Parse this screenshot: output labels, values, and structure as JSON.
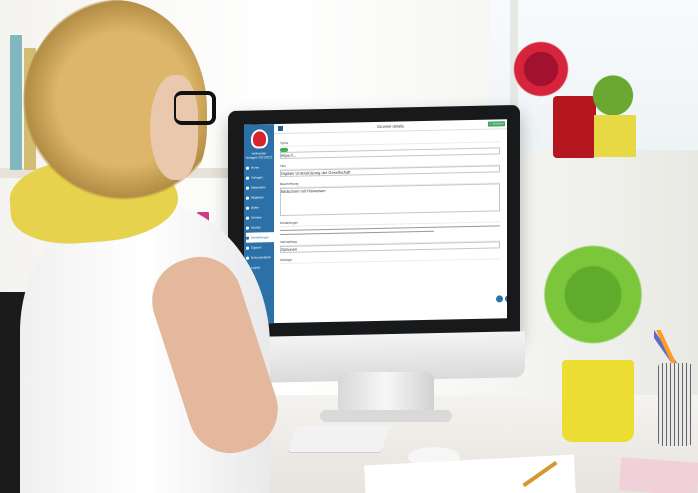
{
  "screen": {
    "title": "Grunnet details",
    "save_label": "✓ Speichern",
    "sidebar_brand": "Hofmeister",
    "sidebar_subtitle": "Vorlagen 2021/2022",
    "nav_items": [
      "Home",
      "Vorlagen",
      "Materialien",
      "Mitglieder",
      "Daten",
      "Termine",
      "Module",
      "Einstellungen",
      "Support",
      "Dokumentation",
      "Logout"
    ],
    "content_rows": [
      "Typus",
      "Titel",
      "Beschreibung",
      "Einstellungen",
      "Verknüpfung",
      "Anhänge"
    ],
    "field_values": [
      "https://...",
      "Digitale Unterstützung der Gesellschaft",
      "Bildschirm mit Hinweisen",
      "Freigaben",
      "Optionen"
    ],
    "badges": [
      "?",
      "✓"
    ]
  }
}
